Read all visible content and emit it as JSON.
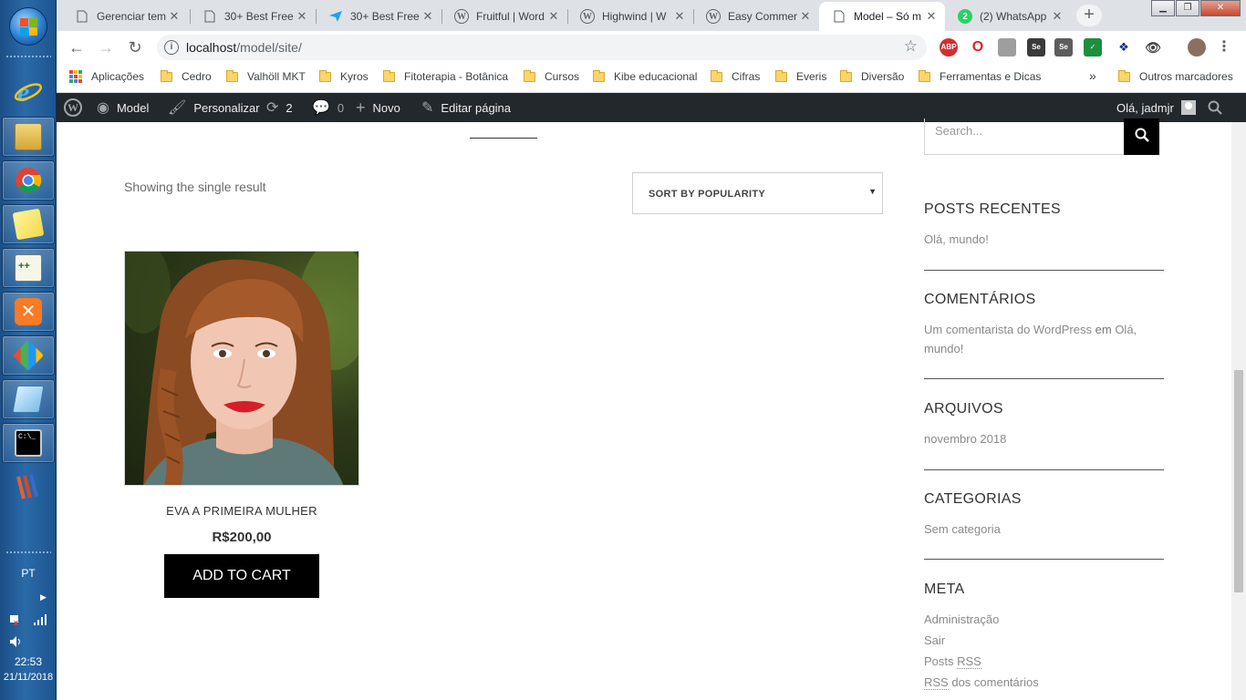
{
  "taskbar": {
    "language": "PT",
    "time": "22:53",
    "date": "21/11/2018",
    "apps": [
      {
        "name": "internet-explorer-icon"
      },
      {
        "name": "file-explorer-icon"
      },
      {
        "name": "chrome-icon"
      },
      {
        "name": "sticky-notes-icon"
      },
      {
        "name": "notepad-plus-plus-icon"
      },
      {
        "name": "xampp-icon"
      },
      {
        "name": "git-icon"
      },
      {
        "name": "editor-icon"
      },
      {
        "name": "command-prompt-icon"
      },
      {
        "name": "app-icon"
      }
    ]
  },
  "browser": {
    "tabs": [
      {
        "title": "Gerenciar tem",
        "active": false
      },
      {
        "title": "30+ Best Free",
        "active": false
      },
      {
        "title": "30+ Best Free",
        "active": false
      },
      {
        "title": "Fruitful | Word",
        "active": false
      },
      {
        "title": "Highwind | W",
        "active": false
      },
      {
        "title": "Easy Commer",
        "active": false
      },
      {
        "title": "Model – Só m",
        "active": true
      },
      {
        "title": "(2) WhatsApp",
        "active": false
      }
    ],
    "whatsapp_badge": "2",
    "url_host": "localhost",
    "url_path": "/model/site/",
    "bookmarks": [
      "Aplicações",
      "Cedro",
      "Valhöll MKT",
      "Kyros",
      "Fitoterapia - Botânica",
      "Cursos",
      "Kibe educacional",
      "Cifras",
      "Everis",
      "Diversão",
      "Ferramentas e Dicas"
    ],
    "bookmarks_overflow": "»",
    "other_bookmarks": "Outros marcadores"
  },
  "adminbar": {
    "site_name": "Model",
    "customize": "Personalizar",
    "updates_count": "2",
    "comments_count": "0",
    "new_label": "Novo",
    "edit_page": "Editar página",
    "greeting": "Olá, jadmjr"
  },
  "shop": {
    "result_count": "Showing the single result",
    "sort_selected": "SORT BY POPULARITY",
    "product": {
      "name": "EVA A PRIMEIRA MULHER",
      "price": "R$200,00",
      "button": "ADD TO CART"
    }
  },
  "sidebar": {
    "search_placeholder": "Search...",
    "recent_posts": {
      "title": "POSTS RECENTES",
      "items": [
        "Olá, mundo!"
      ]
    },
    "comments": {
      "title": "COMENTÁRIOS",
      "author": "Um comentarista do WordPress",
      "sep": "em",
      "post": "Olá,",
      "post2": "mundo!"
    },
    "archives": {
      "title": "ARQUIVOS",
      "items": [
        "novembro 2018"
      ]
    },
    "categories": {
      "title": "CATEGORIAS",
      "items": [
        "Sem categoria"
      ]
    },
    "meta": {
      "title": "META",
      "items": [
        "Administração",
        "Sair"
      ],
      "posts_rss_prefix": "Posts ",
      "rss": "RSS",
      "comments_rss_suffix": " dos comentários"
    }
  },
  "colors": {
    "admin_bar": "#23282d",
    "button": "#000000",
    "tab_strip": "#dee1e6"
  }
}
